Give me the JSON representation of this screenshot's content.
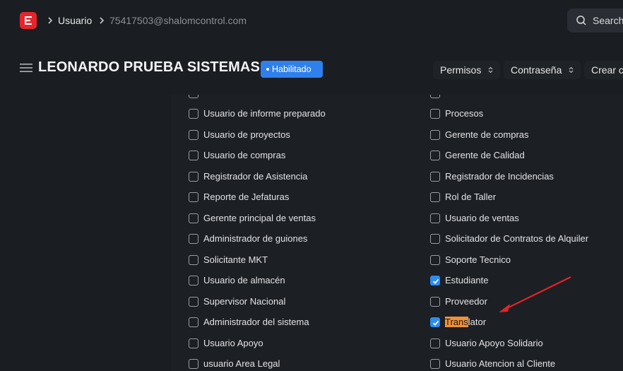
{
  "topbar": {
    "breadcrumb": [
      "Usuario",
      "75417503@shalomcontrol.com"
    ],
    "search_label": "Search"
  },
  "header": {
    "title": "LEONARDO PRUEBA SISTEMAS",
    "status_badge": "Habilitado",
    "buttons": [
      "Permisos",
      "Contraseña",
      "Crear c"
    ]
  },
  "roles": {
    "left": [
      {
        "label": "Usuario de informe preparado",
        "checked": false
      },
      {
        "label": "Usuario de proyectos",
        "checked": false
      },
      {
        "label": "Usuario de compras",
        "checked": false
      },
      {
        "label": "Registrador de Asistencia",
        "checked": false
      },
      {
        "label": "Reporte de Jefaturas",
        "checked": false
      },
      {
        "label": "Gerente principal de ventas",
        "checked": false
      },
      {
        "label": "Administrador de guiones",
        "checked": false
      },
      {
        "label": "Solicitante MKT",
        "checked": false
      },
      {
        "label": "Usuario de almacén",
        "checked": false
      },
      {
        "label": "Supervisor Nacional",
        "checked": false
      },
      {
        "label": "Administrador del sistema",
        "checked": false
      },
      {
        "label": "Usuario Apoyo",
        "checked": false
      },
      {
        "label": "usuario Area Legal",
        "checked": false
      }
    ],
    "right": [
      {
        "label": "Procesos",
        "checked": false
      },
      {
        "label": "Gerente de compras",
        "checked": false
      },
      {
        "label": "Gerente de Calidad",
        "checked": false
      },
      {
        "label": "Registrador de Incidencias",
        "checked": false
      },
      {
        "label": "Rol de Taller",
        "checked": false
      },
      {
        "label": "Usuario de ventas",
        "checked": false
      },
      {
        "label": "Solicitador de Contratos de Alquiler",
        "checked": false
      },
      {
        "label": "Soporte Tecnico",
        "checked": false
      },
      {
        "label": "Estudiante",
        "checked": true
      },
      {
        "label": "Proveedor",
        "checked": false
      },
      {
        "label": "Translator",
        "checked": true,
        "highlight": "Trans"
      },
      {
        "label": "Usuario Apoyo Solidario",
        "checked": false
      },
      {
        "label": "Usuario Atencion al Cliente",
        "checked": false
      }
    ]
  },
  "colors": {
    "accent": "#2f80ed",
    "logo": "#e5242b",
    "highlight": "#f0913a",
    "annotation_arrow": "#e02424"
  }
}
